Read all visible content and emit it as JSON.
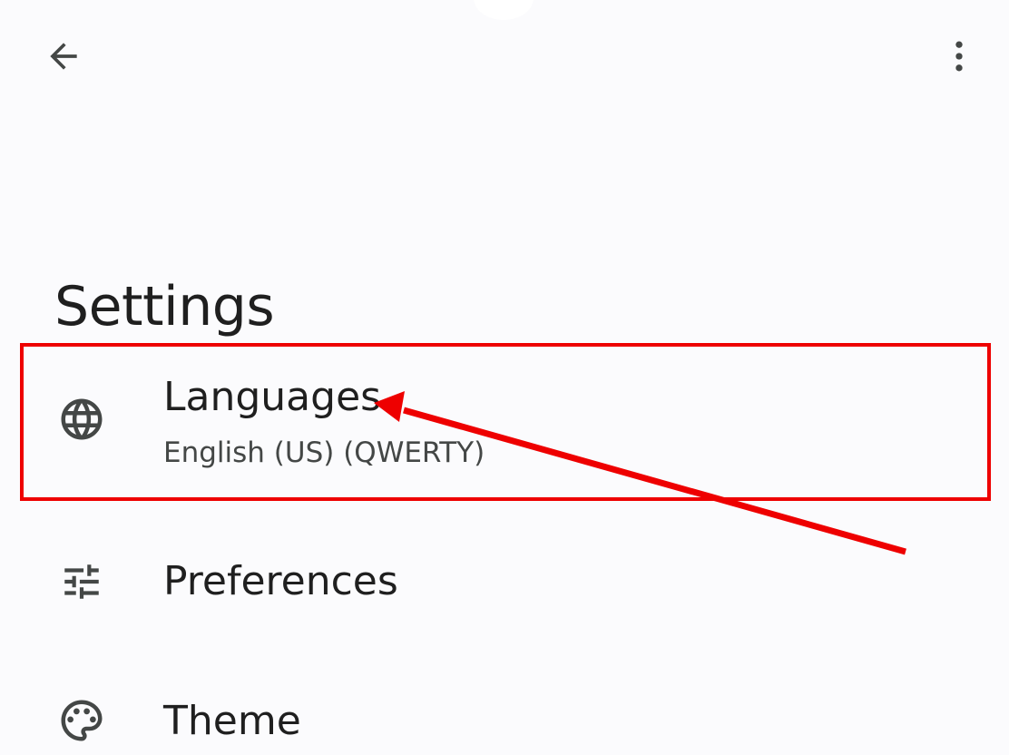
{
  "app_bar": {
    "back_icon": "arrow-back-icon",
    "more_icon": "more-vert-icon"
  },
  "page": {
    "title": "Settings"
  },
  "settings": {
    "items": [
      {
        "icon": "globe-icon",
        "title": "Languages",
        "subtitle": "English (US) (QWERTY)"
      },
      {
        "icon": "tune-sliders-icon",
        "title": "Preferences"
      },
      {
        "icon": "palette-icon",
        "title": "Theme"
      }
    ]
  },
  "annotation": {
    "highlight_color": "#ee0000",
    "target": "Languages"
  },
  "colors": {
    "background": "#fbfbfd",
    "text_primary": "#1f1f1f",
    "text_secondary": "#444746",
    "icon": "#444746"
  }
}
